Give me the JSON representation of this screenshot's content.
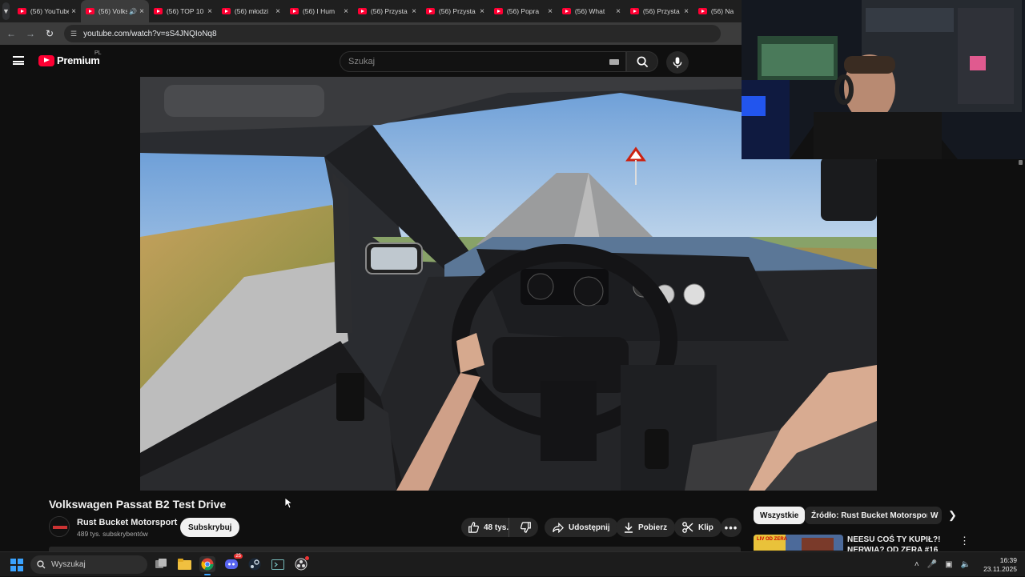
{
  "browser": {
    "tabs": [
      {
        "label": "(56) YouTube",
        "active": false
      },
      {
        "label": "(56) Volkswagen Passat B2",
        "active": true,
        "audio": true
      },
      {
        "label": "(56) TOP 10",
        "active": false
      },
      {
        "label": "(56) młodzi",
        "active": false
      },
      {
        "label": "(56) I Hum",
        "active": false
      },
      {
        "label": "(56) Przysta",
        "active": false
      },
      {
        "label": "(56) Przysta",
        "active": false
      },
      {
        "label": "(56) Popra",
        "active": false
      },
      {
        "label": "(56) What",
        "active": false
      },
      {
        "label": "(56) Przysta",
        "active": false
      },
      {
        "label": "(56) Na",
        "active": false
      }
    ],
    "url": "youtube.com/watch?v=sS4JNQIoNq8"
  },
  "header": {
    "logo_text": "Premium",
    "logo_country": "PL",
    "search_placeholder": "Szukaj"
  },
  "video": {
    "title": "Volkswagen Passat B2 Test Drive",
    "channel_name": "Rust Bucket Motorsport",
    "subscribers": "489 tys. subskrybentów",
    "subscribe_label": "Subskrybuj",
    "likes": "48 tys.",
    "share_label": "Udostępnij",
    "download_label": "Pobierz",
    "clip_label": "Klip"
  },
  "sidebar": {
    "chips": [
      "Wszystkie",
      "Źródło: Rust Bucket Motorsport",
      "W"
    ],
    "recommendation": {
      "title": "NEESU COŚ TY KUPIŁ?! NERWIA? OD ZERA #16",
      "thumb_text": "LIV OD ZERA"
    }
  },
  "taskbar": {
    "search_placeholder": "Wyszukaj",
    "time": "16:39",
    "date": "23.11.2025",
    "discord_badge": "25"
  },
  "colors": {
    "yt_red": "#ff0033",
    "bg": "#0f0f0f",
    "windows_accent": "#3aa3ff"
  }
}
